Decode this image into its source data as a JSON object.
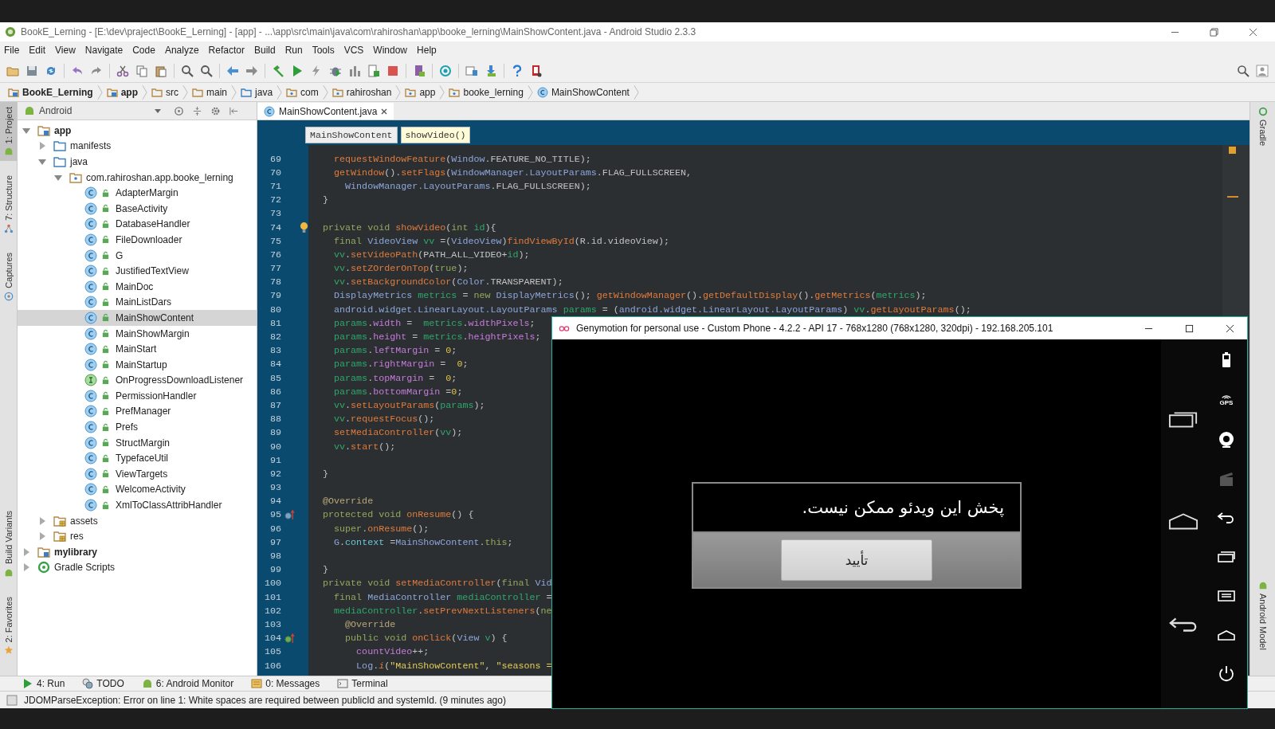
{
  "window": {
    "title": "BookE_Lerning - [E:\\dev\\praject\\BookE_Lerning] - [app] - ...\\app\\src\\main\\java\\com\\rahiroshan\\app\\booke_lerning\\MainShowContent.java - Android Studio 2.3.3"
  },
  "menu": [
    "File",
    "Edit",
    "View",
    "Navigate",
    "Code",
    "Analyze",
    "Refactor",
    "Build",
    "Run",
    "Tools",
    "VCS",
    "Window",
    "Help"
  ],
  "breadcrumb": [
    {
      "label": "BookE_Lerning",
      "kind": "module"
    },
    {
      "label": "app",
      "kind": "module"
    },
    {
      "label": "src",
      "kind": "folder"
    },
    {
      "label": "main",
      "kind": "folder"
    },
    {
      "label": "java",
      "kind": "source"
    },
    {
      "label": "com",
      "kind": "package"
    },
    {
      "label": "rahiroshan",
      "kind": "package"
    },
    {
      "label": "app",
      "kind": "package"
    },
    {
      "label": "booke_lerning",
      "kind": "package"
    },
    {
      "label": "MainShowContent",
      "kind": "class"
    }
  ],
  "left_tool_strip": {
    "top": [
      {
        "label": "1: Project",
        "kind": "android",
        "selected": true
      },
      {
        "label": "7: Structure",
        "kind": "structure",
        "selected": false
      },
      {
        "label": "Captures",
        "kind": "captures",
        "selected": false
      }
    ],
    "bottom": [
      {
        "label": "Build Variants",
        "kind": "android",
        "selected": false
      },
      {
        "label": "2: Favorites",
        "kind": "star",
        "selected": false
      }
    ]
  },
  "project_panel": {
    "view": "Android",
    "tree": [
      {
        "label": "app",
        "kind": "module",
        "expanded": true,
        "selected": false,
        "children": [
          {
            "label": "manifests",
            "kind": "folder",
            "expanded": false,
            "selected": false
          },
          {
            "label": "java",
            "kind": "folder",
            "expanded": true,
            "selected": false,
            "children": [
              {
                "label": "com.rahiroshan.app.booke_lerning",
                "kind": "package",
                "expanded": true,
                "selected": false,
                "children": [
                  {
                    "label": "AdapterMargin",
                    "kind": "class",
                    "selected": false
                  },
                  {
                    "label": "BaseActivity",
                    "kind": "class",
                    "selected": false
                  },
                  {
                    "label": "DatabaseHandler",
                    "kind": "class",
                    "selected": false
                  },
                  {
                    "label": "FileDownloader",
                    "kind": "class",
                    "selected": false
                  },
                  {
                    "label": "G",
                    "kind": "class",
                    "selected": false
                  },
                  {
                    "label": "JustifiedTextView",
                    "kind": "class",
                    "selected": false
                  },
                  {
                    "label": "MainDoc",
                    "kind": "class",
                    "selected": false
                  },
                  {
                    "label": "MainListDars",
                    "kind": "class",
                    "selected": false
                  },
                  {
                    "label": "MainShowContent",
                    "kind": "class",
                    "selected": true
                  },
                  {
                    "label": "MainShowMargin",
                    "kind": "class",
                    "selected": false
                  },
                  {
                    "label": "MainStart",
                    "kind": "class",
                    "selected": false
                  },
                  {
                    "label": "MainStartup",
                    "kind": "class",
                    "selected": false
                  },
                  {
                    "label": "OnProgressDownloadListener",
                    "kind": "interface",
                    "selected": false
                  },
                  {
                    "label": "PermissionHandler",
                    "kind": "class",
                    "selected": false
                  },
                  {
                    "label": "PrefManager",
                    "kind": "class",
                    "selected": false
                  },
                  {
                    "label": "Prefs",
                    "kind": "class",
                    "selected": false
                  },
                  {
                    "label": "StructMargin",
                    "kind": "class",
                    "selected": false
                  },
                  {
                    "label": "TypefaceUtil",
                    "kind": "class",
                    "selected": false
                  },
                  {
                    "label": "ViewTargets",
                    "kind": "class",
                    "selected": false
                  },
                  {
                    "label": "WelcomeActivity",
                    "kind": "class",
                    "selected": false
                  },
                  {
                    "label": "XmlToClassAttribHandler",
                    "kind": "class",
                    "selected": false
                  }
                ]
              }
            ]
          },
          {
            "label": "assets",
            "kind": "resfolder",
            "expanded": false,
            "selected": false
          },
          {
            "label": "res",
            "kind": "resfolder",
            "expanded": false,
            "selected": false
          }
        ]
      },
      {
        "label": "mylibrary",
        "kind": "module",
        "expanded": false,
        "selected": false
      },
      {
        "label": "Gradle Scripts",
        "kind": "gradle",
        "expanded": false,
        "selected": false
      }
    ]
  },
  "editor": {
    "tabs": [
      {
        "label": "MainShowContent.java",
        "selected": true
      }
    ],
    "crumbs": [
      {
        "label": "MainShowContent",
        "selected": false
      },
      {
        "label": "showVideo()",
        "selected": true
      }
    ],
    "lines": [
      {
        "number": "69",
        "tokens": [
          {
            "kind": "method",
            "text": "    requestWindowFeature"
          },
          {
            "kind": "plain",
            "text": "("
          },
          {
            "kind": "type",
            "text": "Window"
          },
          {
            "kind": "plain",
            "text": ".FEATURE_NO_TITLE);"
          }
        ]
      },
      {
        "number": "70",
        "tokens": [
          {
            "kind": "method",
            "text": "    getWindow"
          },
          {
            "kind": "plain",
            "text": "()."
          },
          {
            "kind": "method",
            "text": "setFlags"
          },
          {
            "kind": "plain",
            "text": "("
          },
          {
            "kind": "type",
            "text": "WindowManager.LayoutParams"
          },
          {
            "kind": "plain",
            "text": ".FLAG_FULLSCREEN,"
          }
        ]
      },
      {
        "number": "71",
        "tokens": [
          {
            "kind": "type",
            "text": "      WindowManager.LayoutParams"
          },
          {
            "kind": "plain",
            "text": ".FLAG_FULLSCREEN);"
          }
        ]
      },
      {
        "number": "72",
        "tokens": [
          {
            "kind": "plain",
            "text": "  }"
          }
        ]
      },
      {
        "number": "73"
      },
      {
        "number": "74",
        "marker": {
          "kind": "bulb"
        },
        "tokens": [
          {
            "kind": "keyword",
            "text": "  private void "
          },
          {
            "kind": "method",
            "text": "showVideo"
          },
          {
            "kind": "plain",
            "text": "("
          },
          {
            "kind": "keyword",
            "text": "int "
          },
          {
            "kind": "var",
            "text": "id"
          },
          {
            "kind": "plain",
            "text": "){"
          }
        ]
      },
      {
        "number": "75",
        "tokens": [
          {
            "kind": "keyword",
            "text": "    final "
          },
          {
            "kind": "type",
            "text": "VideoView "
          },
          {
            "kind": "var",
            "text": "vv"
          },
          {
            "kind": "plain",
            "text": " =("
          },
          {
            "kind": "type",
            "text": "VideoView"
          },
          {
            "kind": "plain",
            "text": ")"
          },
          {
            "kind": "method",
            "text": "findViewById"
          },
          {
            "kind": "plain",
            "text": "(R.id.videoView);"
          }
        ]
      },
      {
        "number": "76",
        "tokens": [
          {
            "kind": "var",
            "text": "    vv"
          },
          {
            "kind": "plain",
            "text": "."
          },
          {
            "kind": "method",
            "text": "setVideoPath"
          },
          {
            "kind": "plain",
            "text": "(PATH_ALL_VIDEO+"
          },
          {
            "kind": "var",
            "text": "id"
          },
          {
            "kind": "plain",
            "text": ");"
          }
        ]
      },
      {
        "number": "77",
        "tokens": [
          {
            "kind": "var",
            "text": "    vv"
          },
          {
            "kind": "plain",
            "text": "."
          },
          {
            "kind": "method",
            "text": "setZOrderOnTop"
          },
          {
            "kind": "plain",
            "text": "("
          },
          {
            "kind": "keyword",
            "text": "true"
          },
          {
            "kind": "plain",
            "text": ");"
          }
        ]
      },
      {
        "number": "78",
        "tokens": [
          {
            "kind": "var",
            "text": "    vv"
          },
          {
            "kind": "plain",
            "text": "."
          },
          {
            "kind": "method",
            "text": "setBackgroundColor"
          },
          {
            "kind": "plain",
            "text": "("
          },
          {
            "kind": "type",
            "text": "Color"
          },
          {
            "kind": "plain",
            "text": ".TRANSPARENT);"
          }
        ]
      },
      {
        "number": "79",
        "tokens": [
          {
            "kind": "type",
            "text": "    DisplayMetrics "
          },
          {
            "kind": "var",
            "text": "metrics"
          },
          {
            "kind": "plain",
            "text": " = "
          },
          {
            "kind": "keyword",
            "text": "new "
          },
          {
            "kind": "type",
            "text": "DisplayMetrics"
          },
          {
            "kind": "plain",
            "text": "(); "
          },
          {
            "kind": "method",
            "text": "getWindowManager"
          },
          {
            "kind": "plain",
            "text": "()."
          },
          {
            "kind": "method",
            "text": "getDefaultDisplay"
          },
          {
            "kind": "plain",
            "text": "()."
          },
          {
            "kind": "method",
            "text": "getMetrics"
          },
          {
            "kind": "plain",
            "text": "("
          },
          {
            "kind": "var",
            "text": "metrics"
          },
          {
            "kind": "plain",
            "text": ");"
          }
        ]
      },
      {
        "number": "80",
        "tokens": [
          {
            "kind": "type",
            "text": "    android.widget.LinearLayout.LayoutParams "
          },
          {
            "kind": "var",
            "text": "params"
          },
          {
            "kind": "plain",
            "text": " = ("
          },
          {
            "kind": "type",
            "text": "android.widget.LinearLayout.LayoutParams"
          },
          {
            "kind": "plain",
            "text": ") "
          },
          {
            "kind": "var",
            "text": "vv"
          },
          {
            "kind": "plain",
            "text": "."
          },
          {
            "kind": "method",
            "text": "getLayoutParams"
          },
          {
            "kind": "plain",
            "text": "();"
          }
        ]
      },
      {
        "number": "81",
        "tokens": [
          {
            "kind": "var",
            "text": "    params"
          },
          {
            "kind": "plain",
            "text": "."
          },
          {
            "kind": "field",
            "text": "width"
          },
          {
            "kind": "plain",
            "text": " =  "
          },
          {
            "kind": "var",
            "text": "metrics"
          },
          {
            "kind": "plain",
            "text": "."
          },
          {
            "kind": "field",
            "text": "widthPixels"
          },
          {
            "kind": "plain",
            "text": ";"
          }
        ]
      },
      {
        "number": "82",
        "tokens": [
          {
            "kind": "var",
            "text": "    params"
          },
          {
            "kind": "plain",
            "text": "."
          },
          {
            "kind": "field",
            "text": "height"
          },
          {
            "kind": "plain",
            "text": " = "
          },
          {
            "kind": "var",
            "text": "metrics"
          },
          {
            "kind": "plain",
            "text": "."
          },
          {
            "kind": "field",
            "text": "heightPixels"
          },
          {
            "kind": "plain",
            "text": ";"
          }
        ]
      },
      {
        "number": "83",
        "tokens": [
          {
            "kind": "var",
            "text": "    params"
          },
          {
            "kind": "plain",
            "text": "."
          },
          {
            "kind": "field",
            "text": "leftMargin"
          },
          {
            "kind": "plain",
            "text": " = "
          },
          {
            "kind": "number",
            "text": "0"
          },
          {
            "kind": "plain",
            "text": ";"
          }
        ]
      },
      {
        "number": "84",
        "tokens": [
          {
            "kind": "var",
            "text": "    params"
          },
          {
            "kind": "plain",
            "text": "."
          },
          {
            "kind": "field",
            "text": "rightMargin"
          },
          {
            "kind": "plain",
            "text": " =  "
          },
          {
            "kind": "number",
            "text": "0"
          },
          {
            "kind": "plain",
            "text": ";"
          }
        ]
      },
      {
        "number": "85",
        "tokens": [
          {
            "kind": "var",
            "text": "    params"
          },
          {
            "kind": "plain",
            "text": "."
          },
          {
            "kind": "field",
            "text": "topMargin"
          },
          {
            "kind": "plain",
            "text": " =  "
          },
          {
            "kind": "number",
            "text": "0"
          },
          {
            "kind": "plain",
            "text": ";"
          }
        ]
      },
      {
        "number": "86",
        "tokens": [
          {
            "kind": "var",
            "text": "    params"
          },
          {
            "kind": "plain",
            "text": "."
          },
          {
            "kind": "field",
            "text": "bottomMargin"
          },
          {
            "kind": "plain",
            "text": " ="
          },
          {
            "kind": "number",
            "text": "0"
          },
          {
            "kind": "plain",
            "text": ";"
          }
        ]
      },
      {
        "number": "87",
        "tokens": [
          {
            "kind": "var",
            "text": "    vv"
          },
          {
            "kind": "plain",
            "text": "."
          },
          {
            "kind": "method",
            "text": "setLayoutParams"
          },
          {
            "kind": "plain",
            "text": "("
          },
          {
            "kind": "var",
            "text": "params"
          },
          {
            "kind": "plain",
            "text": ");"
          }
        ]
      },
      {
        "number": "88",
        "tokens": [
          {
            "kind": "var",
            "text": "    vv"
          },
          {
            "kind": "plain",
            "text": "."
          },
          {
            "kind": "method",
            "text": "requestFocus"
          },
          {
            "kind": "plain",
            "text": "();"
          }
        ]
      },
      {
        "number": "89",
        "tokens": [
          {
            "kind": "method",
            "text": "    setMediaController"
          },
          {
            "kind": "plain",
            "text": "("
          },
          {
            "kind": "var",
            "text": "vv"
          },
          {
            "kind": "plain",
            "text": ");"
          }
        ]
      },
      {
        "number": "90",
        "tokens": [
          {
            "kind": "var",
            "text": "    vv"
          },
          {
            "kind": "plain",
            "text": "."
          },
          {
            "kind": "method",
            "text": "start"
          },
          {
            "kind": "plain",
            "text": "();"
          }
        ]
      },
      {
        "number": "91"
      },
      {
        "number": "92",
        "tokens": [
          {
            "kind": "plain",
            "text": "  }"
          }
        ]
      },
      {
        "number": "93"
      },
      {
        "number": "94",
        "tokens": [
          {
            "kind": "annotation",
            "text": "  @Override"
          }
        ]
      },
      {
        "number": "95",
        "marker": {
          "kind": "overrides"
        },
        "tokens": [
          {
            "kind": "keyword",
            "text": "  protected void "
          },
          {
            "kind": "method",
            "text": "onResume"
          },
          {
            "kind": "plain",
            "text": "() {"
          }
        ]
      },
      {
        "number": "96",
        "tokens": [
          {
            "kind": "keyword",
            "text": "    super"
          },
          {
            "kind": "plain",
            "text": "."
          },
          {
            "kind": "method",
            "text": "onResume"
          },
          {
            "kind": "plain",
            "text": "();"
          }
        ]
      },
      {
        "number": "97",
        "tokens": [
          {
            "kind": "type",
            "text": "    G"
          },
          {
            "kind": "plain",
            "text": "."
          },
          {
            "kind": "member",
            "text": "context"
          },
          {
            "kind": "plain",
            "text": " ="
          },
          {
            "kind": "type",
            "text": "MainShowContent"
          },
          {
            "kind": "plain",
            "text": "."
          },
          {
            "kind": "keyword",
            "text": "this"
          },
          {
            "kind": "plain",
            "text": ";"
          }
        ]
      },
      {
        "number": "98"
      },
      {
        "number": "99",
        "tokens": [
          {
            "kind": "plain",
            "text": "  }"
          }
        ]
      },
      {
        "number": "100",
        "tokens": [
          {
            "kind": "keyword",
            "text": "  private void "
          },
          {
            "kind": "method",
            "text": "setMediaController"
          },
          {
            "kind": "plain",
            "text": "("
          },
          {
            "kind": "keyword",
            "text": "final "
          },
          {
            "kind": "type",
            "text": "Vid"
          }
        ]
      },
      {
        "number": "101",
        "tokens": [
          {
            "kind": "keyword",
            "text": "    final "
          },
          {
            "kind": "type",
            "text": "MediaController "
          },
          {
            "kind": "var",
            "text": "mediaController"
          },
          {
            "kind": "plain",
            "text": " ="
          }
        ]
      },
      {
        "number": "102",
        "tokens": [
          {
            "kind": "var",
            "text": "    mediaController"
          },
          {
            "kind": "plain",
            "text": "."
          },
          {
            "kind": "method",
            "text": "setPrevNextListeners"
          },
          {
            "kind": "plain",
            "text": "("
          },
          {
            "kind": "keyword",
            "text": "ne"
          }
        ]
      },
      {
        "number": "103",
        "tokens": [
          {
            "kind": "annotation",
            "text": "      @Override"
          }
        ]
      },
      {
        "number": "104",
        "marker": {
          "kind": "implements"
        },
        "tokens": [
          {
            "kind": "keyword",
            "text": "      public void "
          },
          {
            "kind": "method",
            "text": "onClick"
          },
          {
            "kind": "plain",
            "text": "("
          },
          {
            "kind": "type",
            "text": "View "
          },
          {
            "kind": "var",
            "text": "v"
          },
          {
            "kind": "plain",
            "text": ") {"
          }
        ]
      },
      {
        "number": "105",
        "tokens": [
          {
            "kind": "field",
            "text": "        countVideo"
          },
          {
            "kind": "plain",
            "text": "++;"
          }
        ]
      },
      {
        "number": "106",
        "tokens": [
          {
            "kind": "type",
            "text": "        Log"
          },
          {
            "kind": "plain",
            "text": "."
          },
          {
            "kind": "static",
            "text": "i"
          },
          {
            "kind": "plain",
            "text": "("
          },
          {
            "kind": "string",
            "text": "\"MainShowContent\""
          },
          {
            "kind": "plain",
            "text": ", "
          },
          {
            "kind": "string",
            "text": "\"seasons ="
          }
        ]
      }
    ]
  },
  "right_tool_strip": {
    "top": [
      {
        "label": "Gradle",
        "kind": "gradle"
      }
    ],
    "bottom": [
      {
        "label": "Android Model",
        "kind": "android"
      }
    ]
  },
  "tool_tabs": [
    {
      "label": "4: Run",
      "kind": "run"
    },
    {
      "label": "TODO",
      "kind": "todo"
    },
    {
      "label": "6: Android Monitor",
      "kind": "android"
    },
    {
      "label": "0: Messages",
      "kind": "messages"
    },
    {
      "label": "Terminal",
      "kind": "terminal"
    }
  ],
  "status_bar": {
    "message": "JDOMParseException: Error on line 1: White spaces are required between publicId and systemId. (9 minutes ago)"
  },
  "emulator": {
    "title": "Genymotion for personal use - Custom Phone - 4.2.2 - API 17 - 768x1280 (768x1280, 320dpi) - 192.168.205.101",
    "gps_label": "GPS",
    "dialog": {
      "message": "پخش این ویدئو ممکن نیست.",
      "button": "تأیید"
    }
  }
}
